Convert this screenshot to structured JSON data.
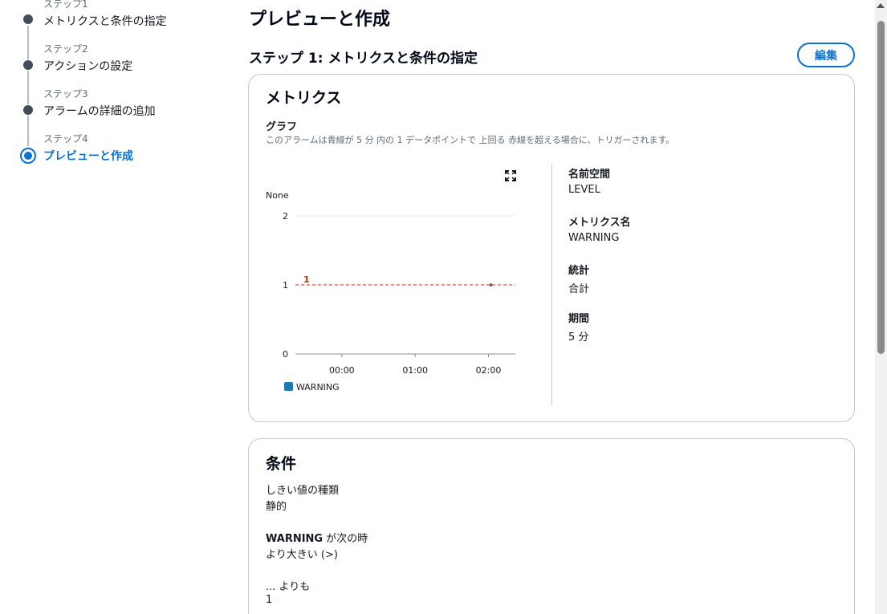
{
  "steps": [
    {
      "num": "ステップ1",
      "label": "メトリクスと条件の指定"
    },
    {
      "num": "ステップ2",
      "label": "アクションの設定"
    },
    {
      "num": "ステップ3",
      "label": "アラームの詳細の追加"
    },
    {
      "num": "ステップ4",
      "label": "プレビューと作成"
    }
  ],
  "page_title": "プレビューと作成",
  "section_title": "ステップ 1: メトリクスと条件の指定",
  "edit_label": "編集",
  "metrics_card": {
    "title": "メトリクス",
    "graph_label": "グラフ",
    "graph_desc": "このアラームは青線が 5 分 内の 1 データポイントで 上回る 赤線を超える場合に、トリガーされます。",
    "details": [
      {
        "key": "名前空間",
        "value": "LEVEL"
      },
      {
        "key": "メトリクス名",
        "value": "WARNING"
      },
      {
        "key": "統計",
        "value": "合計"
      },
      {
        "key": "期間",
        "value": "5 分"
      }
    ]
  },
  "chart_data": {
    "type": "line",
    "unit_label": "None",
    "y_ticks": [
      "0",
      "1",
      "2"
    ],
    "ylim": [
      0,
      2
    ],
    "x_ticks": [
      "00:00",
      "01:00",
      "02:00"
    ],
    "threshold": {
      "value": 1,
      "label": "1",
      "color": "#d13212"
    },
    "series": [
      {
        "name": "WARNING",
        "color": "#1f77b4",
        "points": [
          {
            "x": "02:02",
            "y": 1
          }
        ]
      }
    ],
    "legend_placement": "bottom-left",
    "grid": true
  },
  "conditions_card": {
    "title": "条件",
    "threshold_type_label": "しきい値の種類",
    "threshold_type_value": "静的",
    "when_metric": "WARNING",
    "when_suffix": " が次の時",
    "when_value": "より大きい (>)",
    "than_label": "... よりも",
    "than_value": "1"
  },
  "colors": {
    "accent": "#0972d3",
    "threshold": "#d13212",
    "series": "#1f77b4"
  }
}
